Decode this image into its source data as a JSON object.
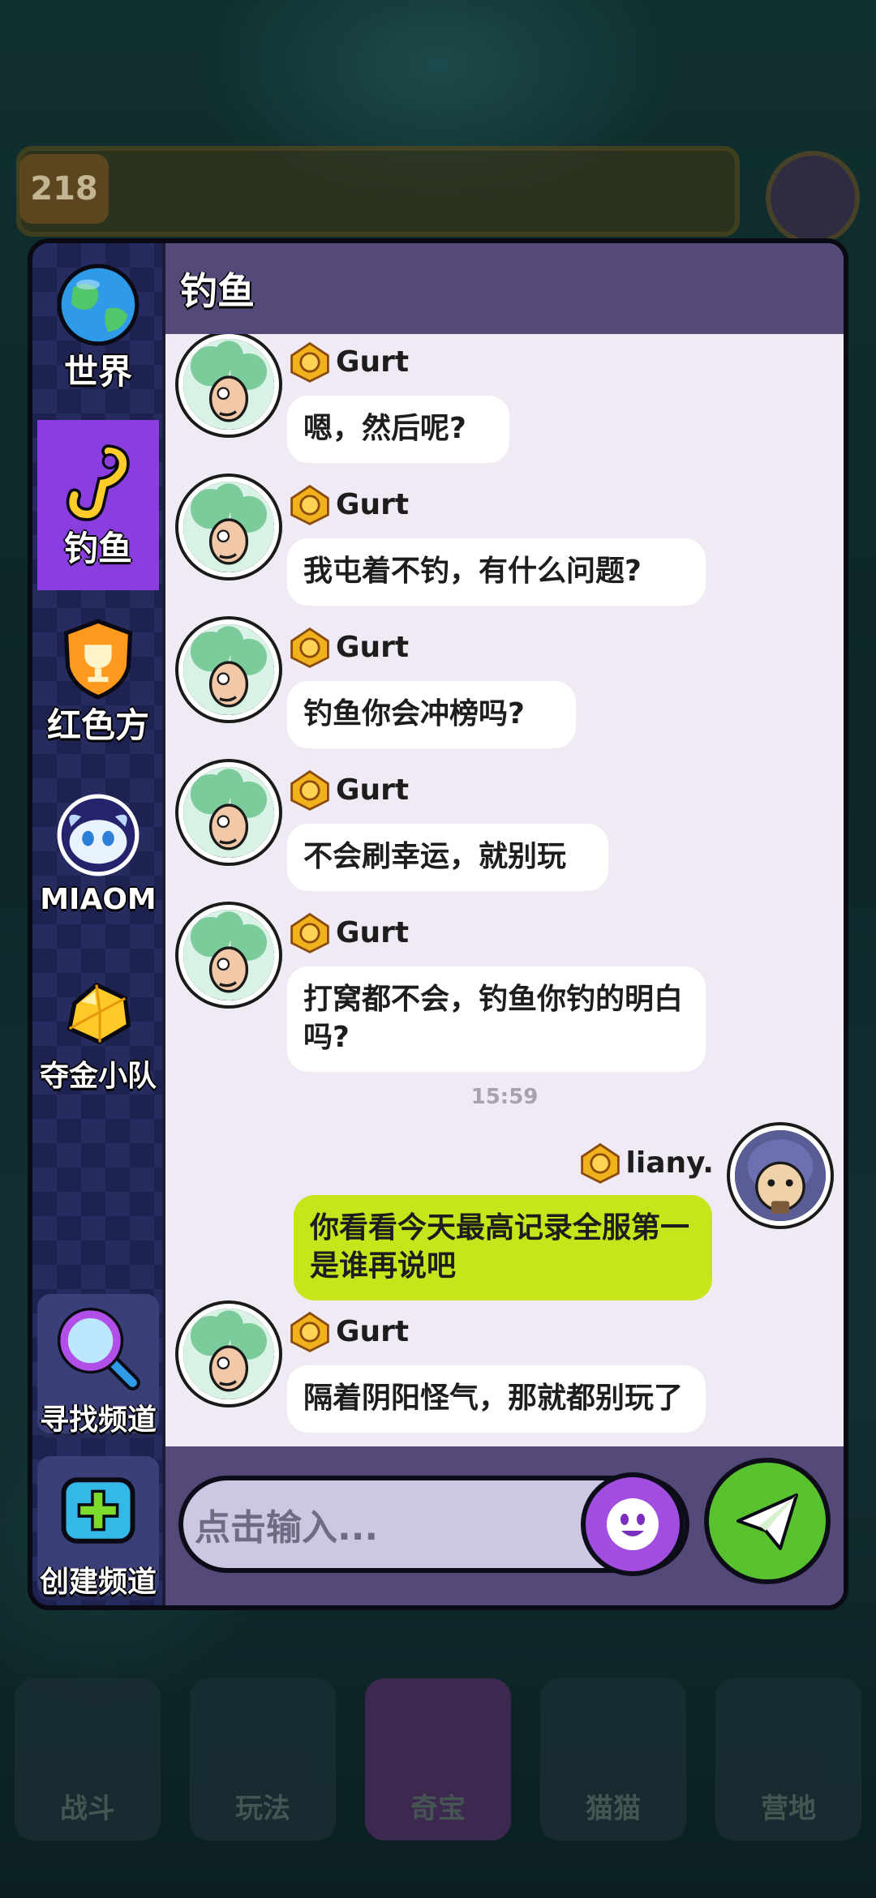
{
  "background": {
    "level": "218",
    "bottom_nav": [
      "战斗",
      "玩法",
      "奇宝",
      "猫猫",
      "营地"
    ]
  },
  "sidebar": {
    "items": [
      {
        "label": "世界",
        "icon": "globe-icon"
      },
      {
        "label": "钓鱼",
        "icon": "fishing-hook-icon",
        "active": true
      },
      {
        "label": "红色方",
        "icon": "trophy-shield-icon"
      },
      {
        "label": "MIAOM",
        "icon": "mascot-avatar-icon"
      },
      {
        "label": "夺金小队",
        "icon": "gold-nugget-icon"
      }
    ],
    "find_channel": "寻找频道",
    "create_channel": "创建频道"
  },
  "chat": {
    "title": "钓鱼",
    "messages": [
      {
        "sender": "Gurt",
        "text": "嗯，然后呢?"
      },
      {
        "sender": "Gurt",
        "text": "我屯着不钓，有什么问题?"
      },
      {
        "sender": "Gurt",
        "text": "钓鱼你会冲榜吗?"
      },
      {
        "sender": "Gurt",
        "text": "不会刷幸运，就别玩"
      },
      {
        "sender": "Gurt",
        "text": "打窝都不会，钓鱼你钓的明白吗?"
      },
      {
        "time": "15:59"
      },
      {
        "sender": "liany.",
        "text": "你看看今天最高记录全服第一是谁再说吧",
        "mine": true
      },
      {
        "sender": "Gurt",
        "text": "隔着阴阳怪气，那就都别玩了"
      }
    ],
    "input_placeholder": "点击输入..."
  },
  "colors": {
    "active_tab": "#8a3ee0",
    "my_bubble": "#c6e51a",
    "send_button": "#58c22f",
    "emoji_button": "#a14ee0",
    "header": "#55497a"
  }
}
